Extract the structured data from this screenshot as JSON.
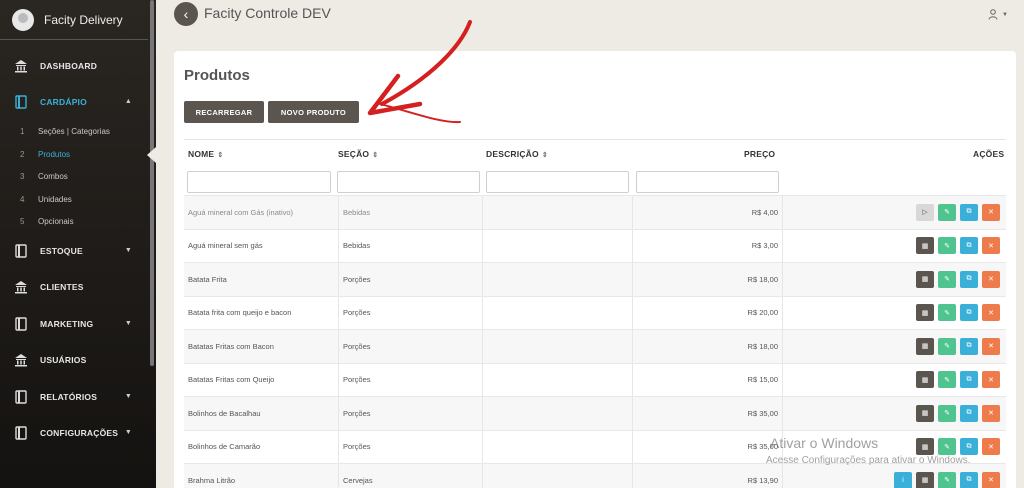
{
  "app": {
    "brand": "Facity Delivery",
    "title": "Facity Controle DEV"
  },
  "sidebar": {
    "items": [
      {
        "label": "DASHBOARD",
        "icon": "bank-icon"
      },
      {
        "label": "CARDÁPIO",
        "icon": "book-icon",
        "active": true
      },
      {
        "label": "ESTOQUE",
        "icon": "book-icon"
      },
      {
        "label": "CLIENTES",
        "icon": "bank-icon"
      },
      {
        "label": "MARKETING",
        "icon": "book-icon"
      },
      {
        "label": "USUÁRIOS",
        "icon": "bank-icon"
      },
      {
        "label": "RELATÓRIOS",
        "icon": "book-icon"
      },
      {
        "label": "CONFIGURAÇÕES",
        "icon": "book-icon"
      }
    ],
    "subitems": [
      {
        "num": "1",
        "label": "Seções | Categorias"
      },
      {
        "num": "2",
        "label": "Produtos",
        "active": true
      },
      {
        "num": "3",
        "label": "Combos"
      },
      {
        "num": "4",
        "label": "Unidades"
      },
      {
        "num": "5",
        "label": "Opcionais"
      }
    ]
  },
  "page": {
    "title": "Produtos",
    "reload_label": "RECARREGAR",
    "new_label": "NOVO PRODUTO"
  },
  "table": {
    "headers": {
      "name": "NOME",
      "section": "SEÇÃO",
      "description": "DESCRIÇÃO",
      "price": "PREÇO",
      "actions": "AÇÕES"
    },
    "rows": [
      {
        "name": "Aguá mineral com Gás (inativo)",
        "section": "Bebidas",
        "description": "",
        "price": "R$ 4,00",
        "inactive": true
      },
      {
        "name": "Aguá mineral sem gás",
        "section": "Bebidas",
        "description": "",
        "price": "R$ 3,00"
      },
      {
        "name": "Batata Frita",
        "section": "Porções",
        "description": "",
        "price": "R$ 18,00"
      },
      {
        "name": "Batata frita com queijo e bacon",
        "section": "Porções",
        "description": "",
        "price": "R$ 20,00"
      },
      {
        "name": "Batatas Fritas com Bacon",
        "section": "Porções",
        "description": "",
        "price": "R$ 18,00"
      },
      {
        "name": "Batatas Fritas com Queijo",
        "section": "Porções",
        "description": "",
        "price": "R$ 15,00"
      },
      {
        "name": "Bolinhos de Bacalhau",
        "section": "Porções",
        "description": "",
        "price": "R$ 35,00"
      },
      {
        "name": "Bolinhos de Camarão",
        "section": "Porções",
        "description": "",
        "price": "R$ 35,00"
      },
      {
        "name": "Brahma Litrão",
        "section": "Cervejas",
        "description": "",
        "price": "R$ 13,90"
      }
    ]
  },
  "watermark": {
    "line1": "Ativar o Windows",
    "line2": "Acesse Configurações para ativar o Windows."
  },
  "colors": {
    "accent": "#3ab0d8",
    "dark_button": "#5a554f",
    "edit": "#4fc48f",
    "delete": "#ee7b4c",
    "annotation_arrow": "#d42020"
  }
}
